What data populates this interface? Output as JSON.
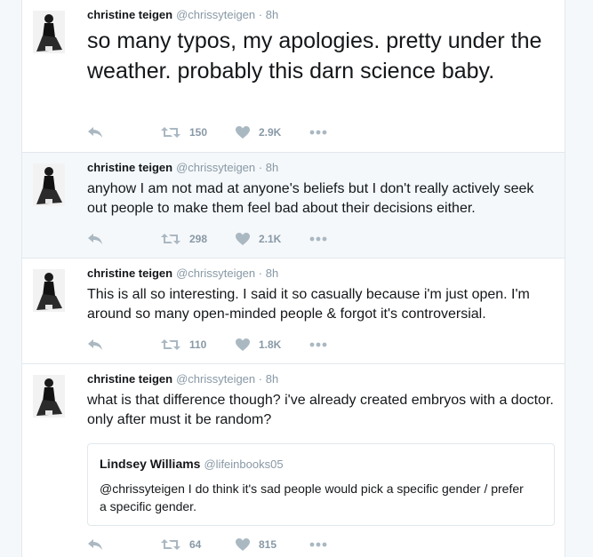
{
  "colors": {
    "text": "#14171a",
    "muted": "#8899a6",
    "border": "#e1e8ed",
    "highlight_bg": "#f5f8fa"
  },
  "icons": {
    "reply": "reply-icon",
    "retweet": "retweet-icon",
    "like": "heart-icon",
    "more": "more-dots-icon"
  },
  "tweets": [
    {
      "name": "christine teigen",
      "handle": "@chrissyteigen",
      "sep": "·",
      "time": "8h",
      "text": "so many typos, my apologies. pretty under the weather. probably this darn science baby.",
      "retweets": "150",
      "likes": "2.9K"
    },
    {
      "name": "christine teigen",
      "handle": "@chrissyteigen",
      "sep": "·",
      "time": "8h",
      "text": "anyhow I am not mad at anyone's beliefs but I don't really actively seek out people to make them feel bad about their decisions either.",
      "retweets": "298",
      "likes": "2.1K"
    },
    {
      "name": "christine teigen",
      "handle": "@chrissyteigen",
      "sep": "·",
      "time": "8h",
      "text": "This is all so interesting. I said it so casually because i'm just open. I'm around so many open-minded people & forgot it's controversial.",
      "retweets": "110",
      "likes": "1.8K"
    },
    {
      "name": "christine teigen",
      "handle": "@chrissyteigen",
      "sep": "·",
      "time": "8h",
      "text": "what is that difference though? i've already created embryos with a doctor. only after must it be random?",
      "retweets": "64",
      "likes": "815",
      "quote": {
        "name": "Lindsey Williams",
        "handle": "@lifeinbooks05",
        "text": "@chrissyteigen I do think it's sad people would pick a specific gender / prefer a specific gender."
      }
    }
  ]
}
